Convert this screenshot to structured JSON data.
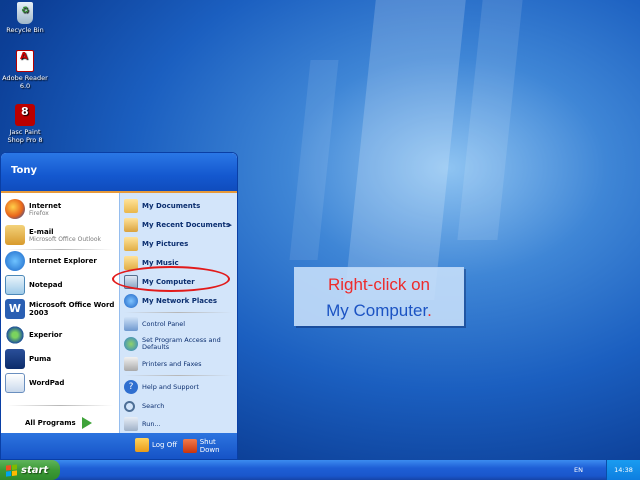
{
  "desktop": {
    "icons": [
      {
        "label": "Recycle Bin",
        "icon": "recycle-bin-icon"
      },
      {
        "label_line1": "Adobe Reader",
        "label_line2": "6.0",
        "icon": "adobe-reader-icon"
      },
      {
        "label_line1": "Jasc Paint",
        "label_line2": "Shop Pro 8",
        "icon": "paint-shop-pro-icon"
      }
    ]
  },
  "start_menu": {
    "user": "Tony",
    "left_items": [
      {
        "title": "Internet",
        "subtitle": "Firefox",
        "icon": "firefox-icon"
      },
      {
        "title": "E-mail",
        "subtitle": "Microsoft Office Outlook",
        "icon": "outlook-icon"
      },
      {
        "title": "Internet Explorer",
        "icon": "internet-explorer-icon"
      },
      {
        "title": "Notepad",
        "icon": "notepad-icon"
      },
      {
        "title_line1": "Microsoft Office Word",
        "title_line2": "2003",
        "icon": "word-icon"
      },
      {
        "title": "Experior",
        "icon": "experior-icon"
      },
      {
        "title": "Puma",
        "icon": "puma-icon"
      },
      {
        "title": "WordPad",
        "icon": "wordpad-icon"
      }
    ],
    "all_programs": "All Programs",
    "right_items": [
      {
        "label": "My Documents",
        "icon": "my-documents-icon"
      },
      {
        "label": "My Recent Documents",
        "icon": "recent-documents-icon"
      },
      {
        "label": "My Pictures",
        "icon": "my-pictures-icon"
      },
      {
        "label": "My Music",
        "icon": "my-music-icon"
      },
      {
        "label": "My Computer",
        "icon": "my-computer-icon"
      },
      {
        "label": "My Network Places",
        "icon": "network-places-icon"
      },
      {
        "label": "Control Panel",
        "icon": "control-panel-icon"
      },
      {
        "label_line1": "Set Program Access and",
        "label_line2": "Defaults",
        "icon": "program-access-icon"
      },
      {
        "label": "Printers and Faxes",
        "icon": "printers-icon"
      },
      {
        "label": "Help and Support",
        "icon": "help-icon"
      },
      {
        "label": "Search",
        "icon": "search-icon"
      },
      {
        "label": "Run...",
        "icon": "run-icon"
      }
    ],
    "log_off": "Log Off",
    "shut_down": "Shut Down"
  },
  "callout": {
    "line1": "Right-click on",
    "line2": "My Computer",
    "period": "."
  },
  "taskbar": {
    "start_label": "start",
    "language": "EN",
    "clock": "14:38"
  },
  "colors": {
    "highlight_oval": "#e21a1a",
    "callout_red": "#ee2b2b",
    "callout_blue": "#1b53c3"
  }
}
